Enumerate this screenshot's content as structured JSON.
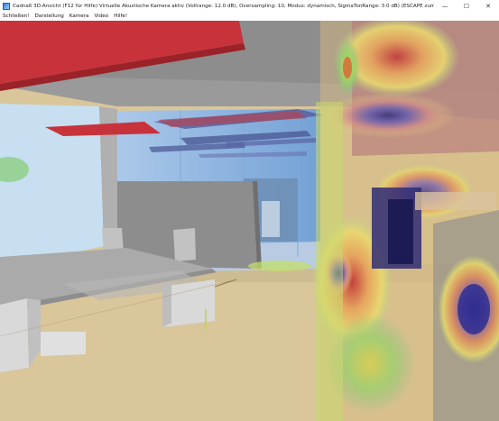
{
  "window": {
    "title": "Cadnaß 3D-Ansicht (F12 für Hilfe) Virtuelle Akustische Kamera aktiv (Vollrange: 12.0 dB), Oversampling: 10, Modus: dynamisch, SigmaTonRange: 3.0 dB) (ESCAPE zum Beenden)",
    "controls": {
      "minimize": "—",
      "maximize": "☐",
      "close": "✕"
    }
  },
  "menu": [
    "Schließen!",
    "Darstellung",
    "Kamera",
    "Video",
    "Hilfe!"
  ],
  "viewport": {
    "colors": {
      "floor": "#d9c69b",
      "ceiling": "#8a8a8a",
      "red_panel": "#c8333b",
      "glass": "#8fb7e6"
    }
  }
}
